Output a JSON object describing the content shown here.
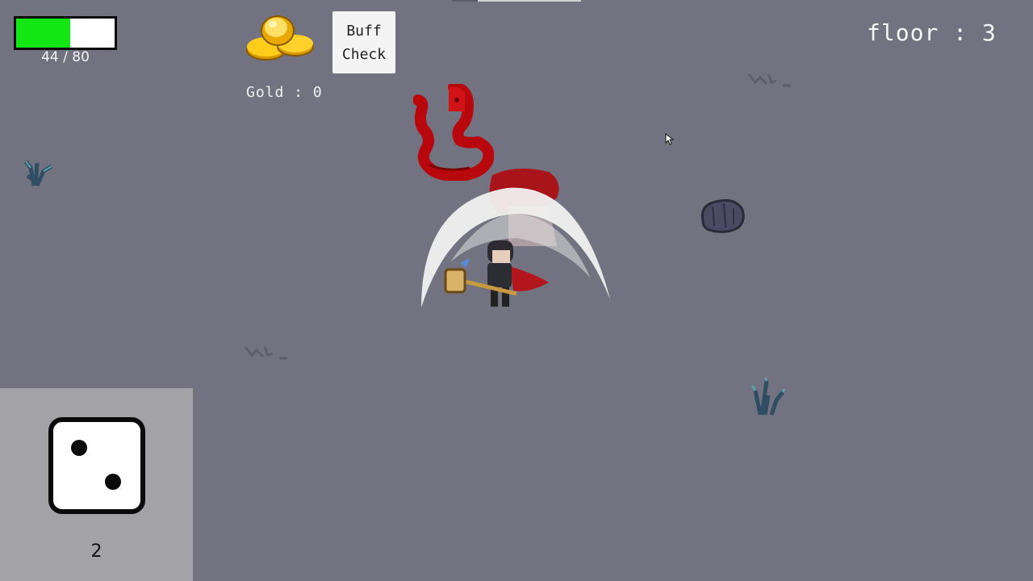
{
  "hud": {
    "health": {
      "current": 44,
      "max": 80,
      "label": "44 / 80",
      "fill_fraction": 0.55,
      "fill_color": "#13e713"
    },
    "gold": {
      "label": "Gold : 0",
      "icon": "gold-coins-icon"
    },
    "buff_button": {
      "line1": "Buff",
      "line2": "Check"
    },
    "floor": {
      "label": "floor : 3"
    }
  },
  "dice": {
    "value": "2",
    "icon": "dice-face-two-icon"
  },
  "world": {
    "enemies": [
      {
        "type": "red-snake"
      },
      {
        "type": "red-demon-ghost"
      }
    ],
    "player": {
      "icon": "knight-with-hammer-icon"
    },
    "attack": {
      "icon": "slash-arc-icon"
    },
    "props": [
      "rock-icon",
      "plant-icon",
      "crack-icon"
    ]
  },
  "colors": {
    "background": "#737280",
    "panel": "#a3a3a7",
    "button": "#f4f4f4"
  }
}
